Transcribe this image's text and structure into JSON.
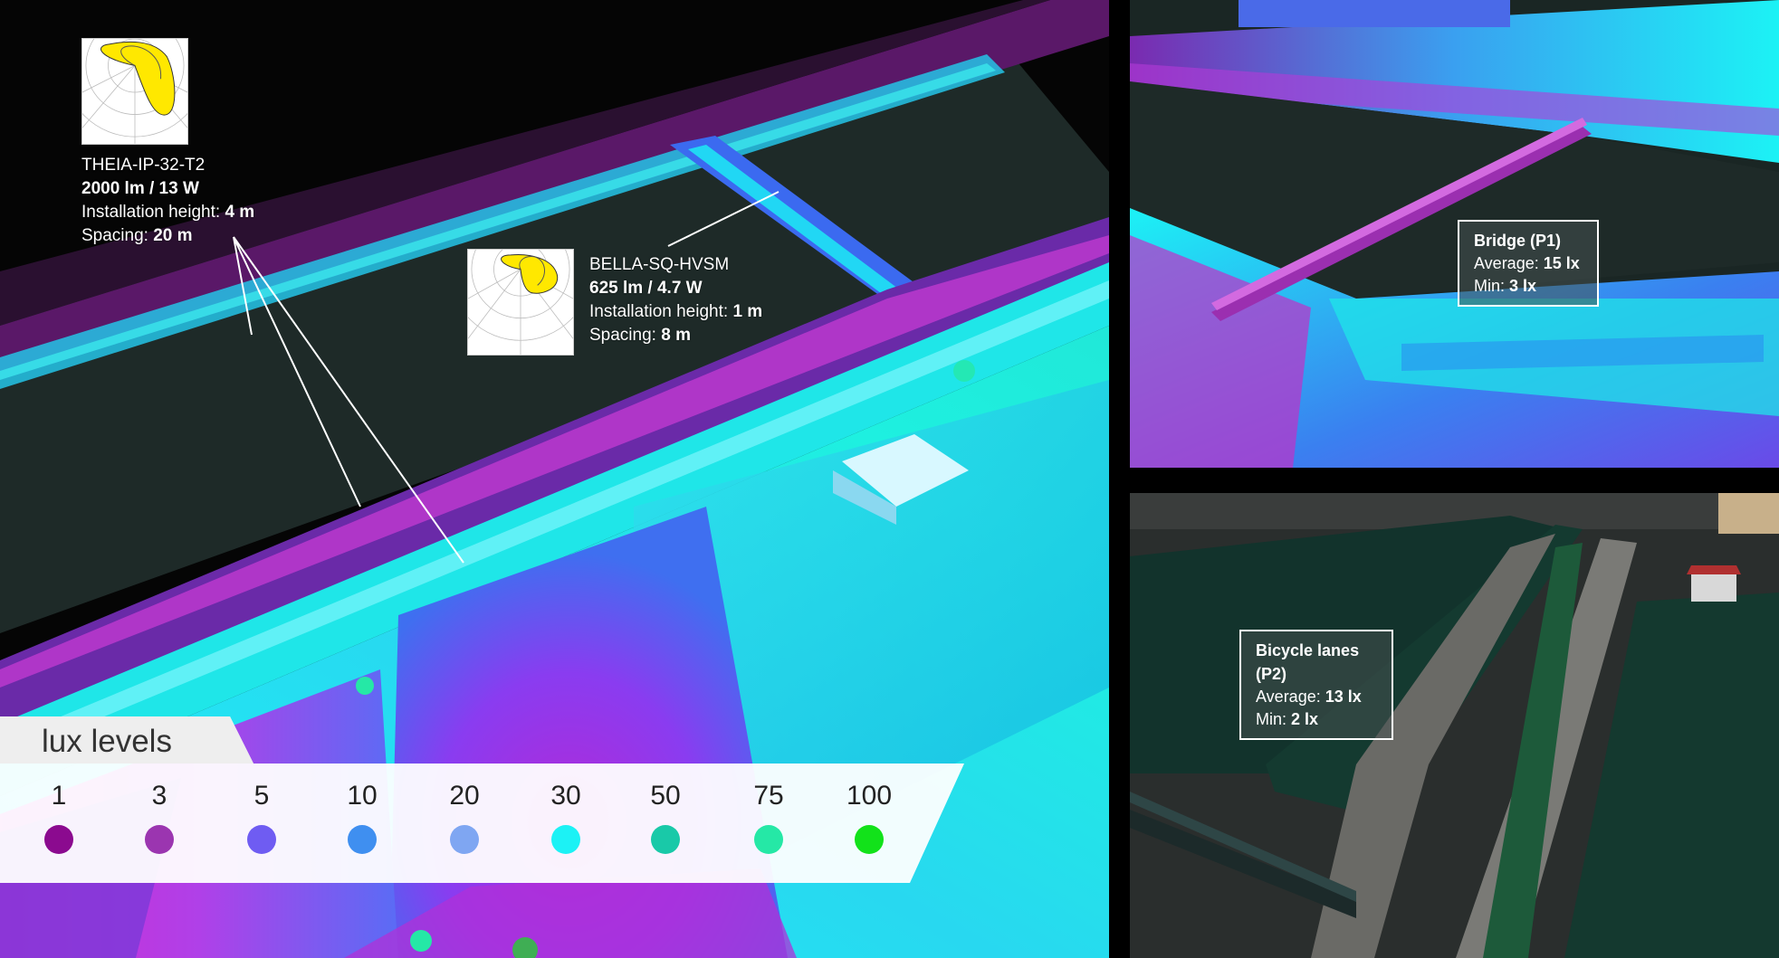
{
  "luminaires": [
    {
      "name": "THEIA-IP-32-T2",
      "flux": "2000 lm / 13 W",
      "height_label": "Installation height:",
      "height_value": "4 m",
      "spacing_label": "Spacing:",
      "spacing_value": "20 m"
    },
    {
      "name": "BELLA-SQ-HVSM",
      "flux": "625 lm / 4.7 W",
      "height_label": "Installation height:",
      "height_value": "1 m",
      "spacing_label": "Spacing:",
      "spacing_value": "8 m"
    }
  ],
  "legend": {
    "title": "lux levels",
    "items": [
      {
        "value": "1",
        "color": "#8b0a8f"
      },
      {
        "value": "3",
        "color": "#9b35b0"
      },
      {
        "value": "5",
        "color": "#6f5cf2"
      },
      {
        "value": "10",
        "color": "#3f8ff0"
      },
      {
        "value": "20",
        "color": "#7fa6f2"
      },
      {
        "value": "30",
        "color": "#1cf2f5"
      },
      {
        "value": "50",
        "color": "#19c9a8"
      },
      {
        "value": "75",
        "color": "#25e8a6"
      },
      {
        "value": "100",
        "color": "#12e21a"
      }
    ]
  },
  "zones": [
    {
      "title": "Bridge (P1)",
      "average_label": "Average:",
      "average_value": "15 lx",
      "min_label": "Min:",
      "min_value": "3 lx"
    },
    {
      "title": "Bicycle lanes (P2)",
      "average_label": "Average:",
      "average_value": "13 lx",
      "min_label": "Min:",
      "min_value": "2 lx"
    }
  ]
}
